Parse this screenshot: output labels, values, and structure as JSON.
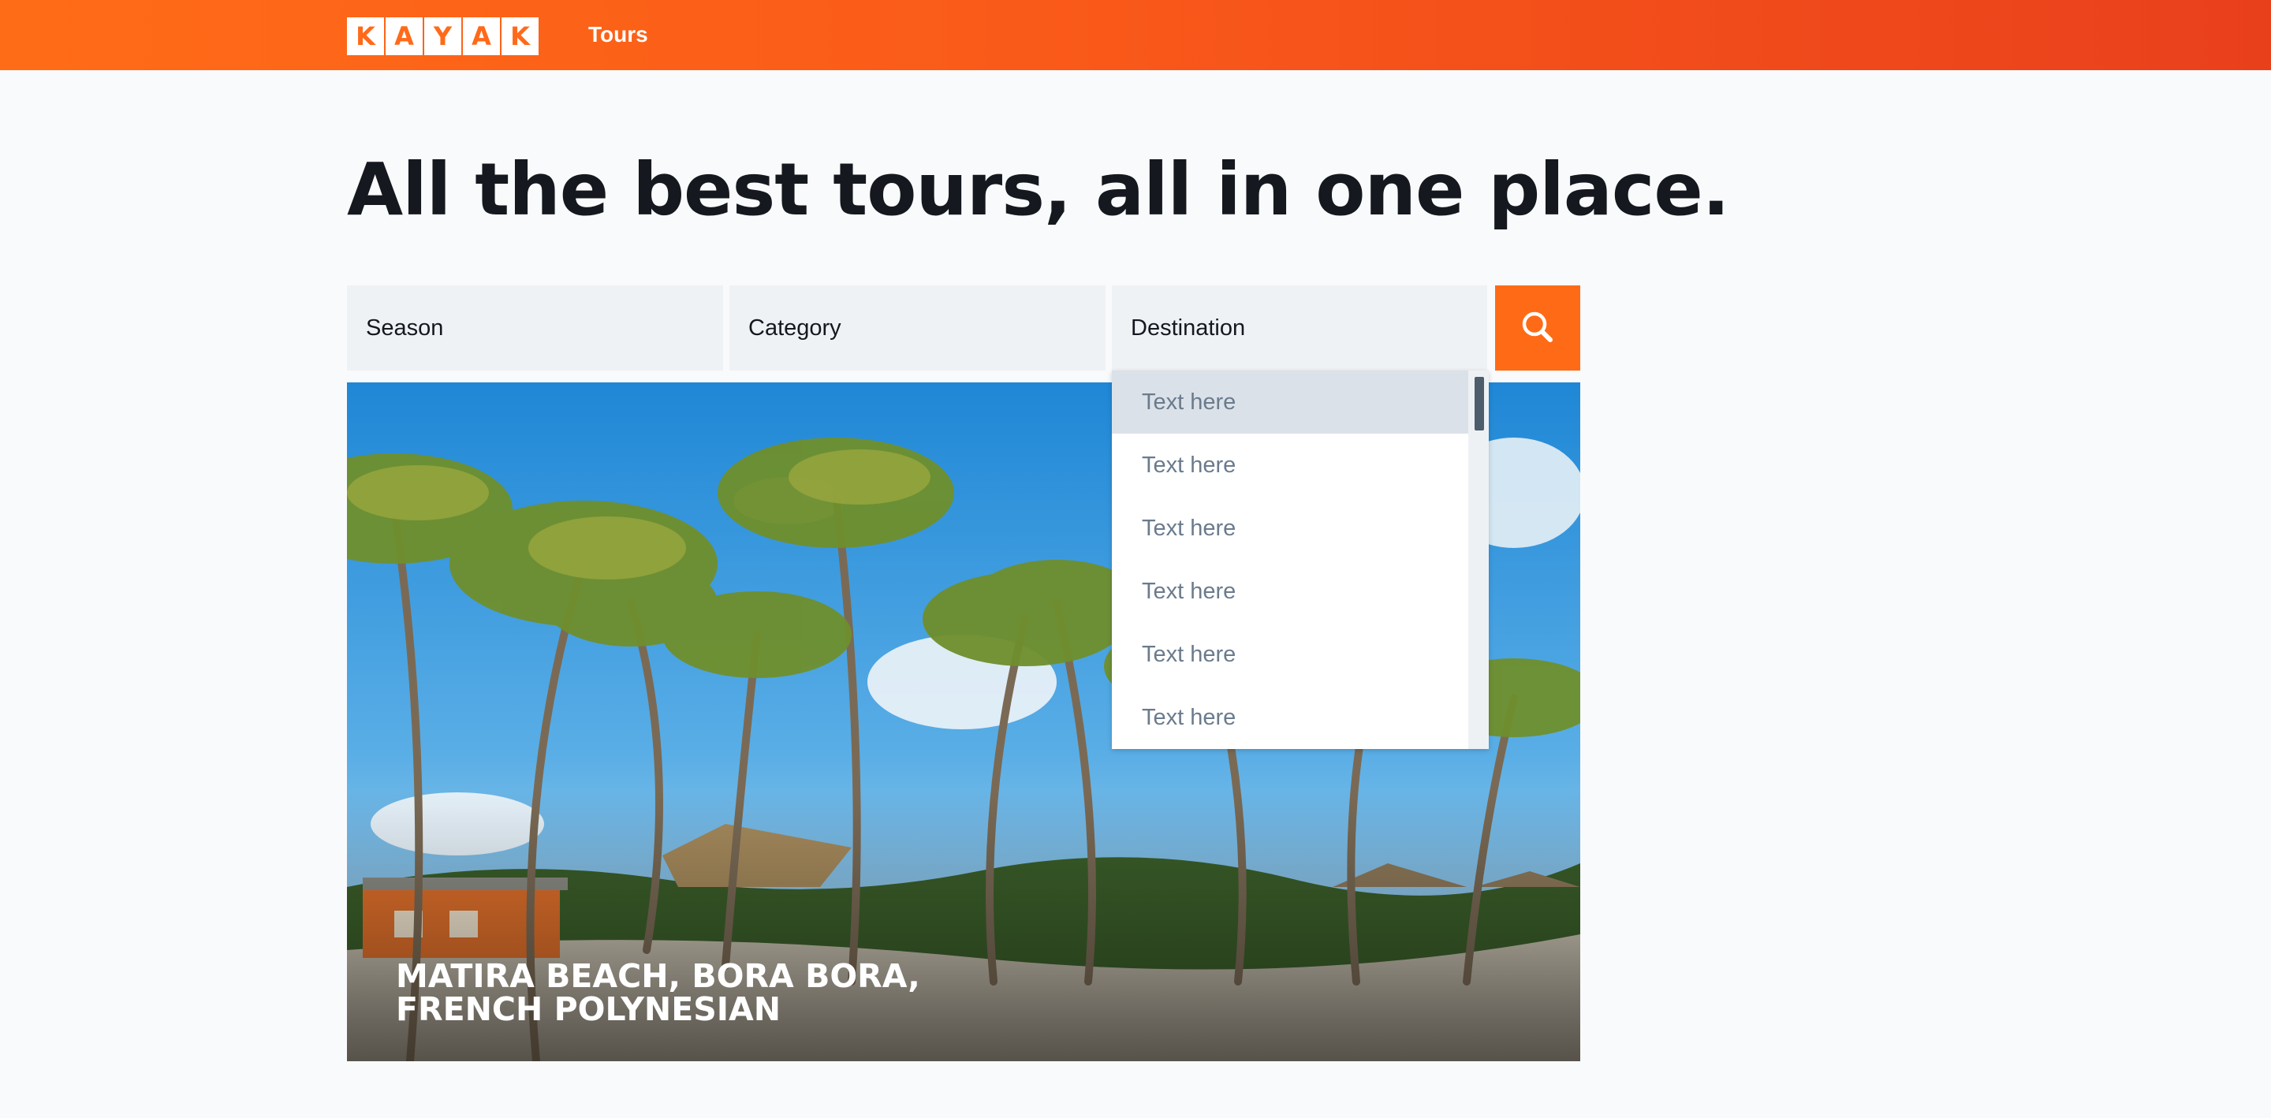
{
  "header": {
    "logo_letters": [
      "K",
      "A",
      "Y",
      "A",
      "K"
    ],
    "nav_link": "Tours",
    "brand_color": "#ff6a17"
  },
  "main": {
    "headline": "All the best tours, all in one place."
  },
  "search": {
    "season_placeholder": "Season",
    "category_placeholder": "Category",
    "destination_placeholder": "Destination",
    "button_icon": "search-icon"
  },
  "dropdown": {
    "options": [
      "Text here",
      "Text here",
      "Text here",
      "Text here",
      "Text here",
      "Text here"
    ],
    "active_index": 0
  },
  "hero": {
    "caption_line1": "MATIRA BEACH, BORA BORA,",
    "caption_line2": "FRENCH POLYNESIAN"
  }
}
